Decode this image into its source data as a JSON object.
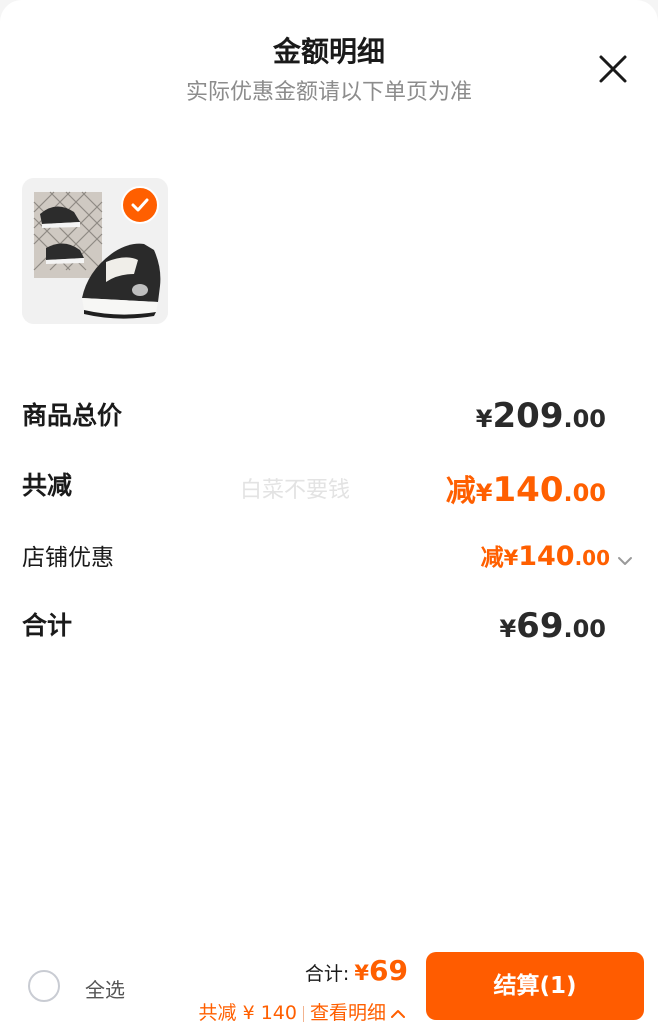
{
  "header": {
    "title": "金额明细",
    "subtitle": "实际优惠金额请以下单页为准"
  },
  "icons": {
    "close": "close-icon",
    "check": "check-icon",
    "chevron_down": "chevron-down-icon",
    "chevron_up": "chevron-up-icon"
  },
  "product": {
    "thumbnail": "sneaker-product-image",
    "selected": true
  },
  "summary": {
    "subtotal": {
      "label": "商品总价",
      "yen": "¥",
      "int": "209",
      "dec": ".00"
    },
    "total_discount": {
      "label": "共减",
      "prefix": "减",
      "yen": "¥",
      "int": "140",
      "dec": ".00"
    },
    "store_discount": {
      "label": "店铺优惠",
      "prefix": "减",
      "yen": "¥",
      "int": "140",
      "dec": ".00"
    },
    "total": {
      "label": "合计",
      "yen": "¥",
      "int": "69",
      "dec": ".00"
    }
  },
  "watermark": "白菜不要钱",
  "footer": {
    "select_all": "全选",
    "total_label": "合计:",
    "total_yen": "¥",
    "total_value": "69",
    "discount_text": "共减 ¥ 140",
    "detail_link": "查看明细",
    "checkout_label": "结算(1)"
  },
  "colors": {
    "accent": "#ff5f00",
    "text": "#1a1a1a",
    "subtle": "#8c8c8c",
    "background": "#ffffff"
  }
}
